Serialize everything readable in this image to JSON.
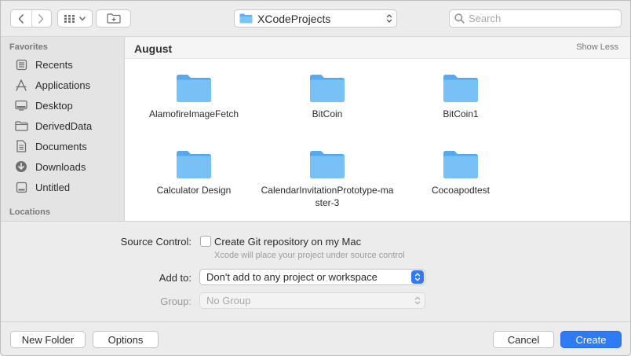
{
  "toolbar": {
    "back_icon": "chevron-left-icon",
    "forward_icon": "chevron-right-icon",
    "view_icon": "grid-view-icon",
    "new_folder_icon": "new-folder-icon",
    "path_location": "XCodeProjects",
    "search_placeholder": "Search"
  },
  "sidebar": {
    "favorites_heading": "Favorites",
    "items": [
      {
        "label": "Recents",
        "icon": "recents-icon"
      },
      {
        "label": "Applications",
        "icon": "applications-icon"
      },
      {
        "label": "Desktop",
        "icon": "desktop-icon"
      },
      {
        "label": "DerivedData",
        "icon": "folder-icon"
      },
      {
        "label": "Documents",
        "icon": "documents-icon"
      },
      {
        "label": "Downloads",
        "icon": "downloads-icon"
      },
      {
        "label": "Untitled",
        "icon": "drive-icon"
      }
    ],
    "locations_heading": "Locations"
  },
  "browser": {
    "group_title": "August",
    "show_less": "Show Less",
    "items": [
      {
        "name": "AlamofireImageFetch"
      },
      {
        "name": "BitCoin"
      },
      {
        "name": "BitCoin1"
      },
      {
        "name": "Calculator Design"
      },
      {
        "name": "CalendarInvitationPrototype-master-3"
      },
      {
        "name": "Cocoapodtest"
      }
    ]
  },
  "options": {
    "source_control_label": "Source Control:",
    "git_checkbox_label": "Create Git repository on my Mac",
    "git_checkbox_checked": false,
    "git_hint": "Xcode will place your project under source control",
    "add_to_label": "Add to:",
    "add_to_value": "Don't add to any project or workspace",
    "group_label": "Group:",
    "group_value": "No Group"
  },
  "footer": {
    "new_folder": "New Folder",
    "options": "Options",
    "cancel": "Cancel",
    "create": "Create"
  },
  "colors": {
    "accent": "#2f7bf6",
    "folder": "#64b5f6"
  }
}
